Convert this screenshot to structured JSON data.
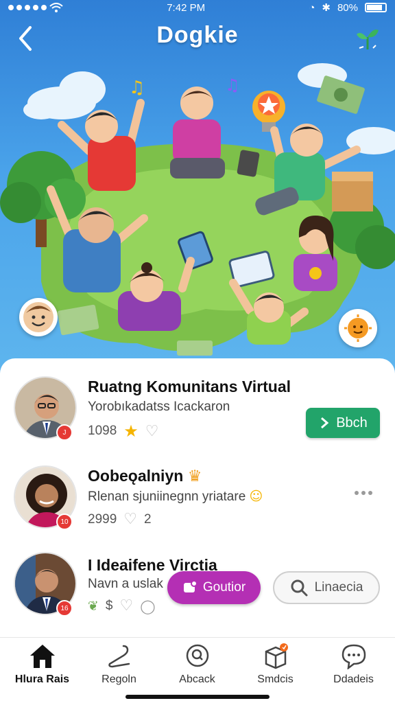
{
  "status_bar": {
    "time": "7:42 PM",
    "battery": "80%"
  },
  "header": {
    "title": "Dogkie"
  },
  "list": [
    {
      "title": "Ruatng Komunitans Virtual",
      "subtitle": "Yorobıkadatss Icackaron",
      "count": "1098",
      "badge": "J",
      "action_label": "Bbch"
    },
    {
      "title": "Oobeǫalniyn",
      "subtitle": "Rlenan sjuniinegnn yriatare",
      "count": "2999",
      "extra": "2",
      "badge": "10"
    },
    {
      "title": "I Ideaifene Virctia",
      "subtitle": "Navn a uslak",
      "extra": "$",
      "badge": "16",
      "primary_action": "Goutior",
      "secondary_action": "Linaecia"
    }
  ],
  "bottom_nav": [
    {
      "label": "Hlura Rais",
      "icon": "home-icon",
      "active": true
    },
    {
      "label": "Regoln",
      "icon": "hanger-icon",
      "active": false
    },
    {
      "label": "Abcack",
      "icon": "search-icon",
      "active": false
    },
    {
      "label": "Smdcis",
      "icon": "box-icon",
      "active": false
    },
    {
      "label": "Ddadeis",
      "icon": "chat-icon",
      "active": false
    }
  ],
  "colors": {
    "hero_blue": "#2f7fd6",
    "accent_green": "#22a46a",
    "accent_purple": "#b42fb4",
    "badge_red": "#e53935"
  }
}
